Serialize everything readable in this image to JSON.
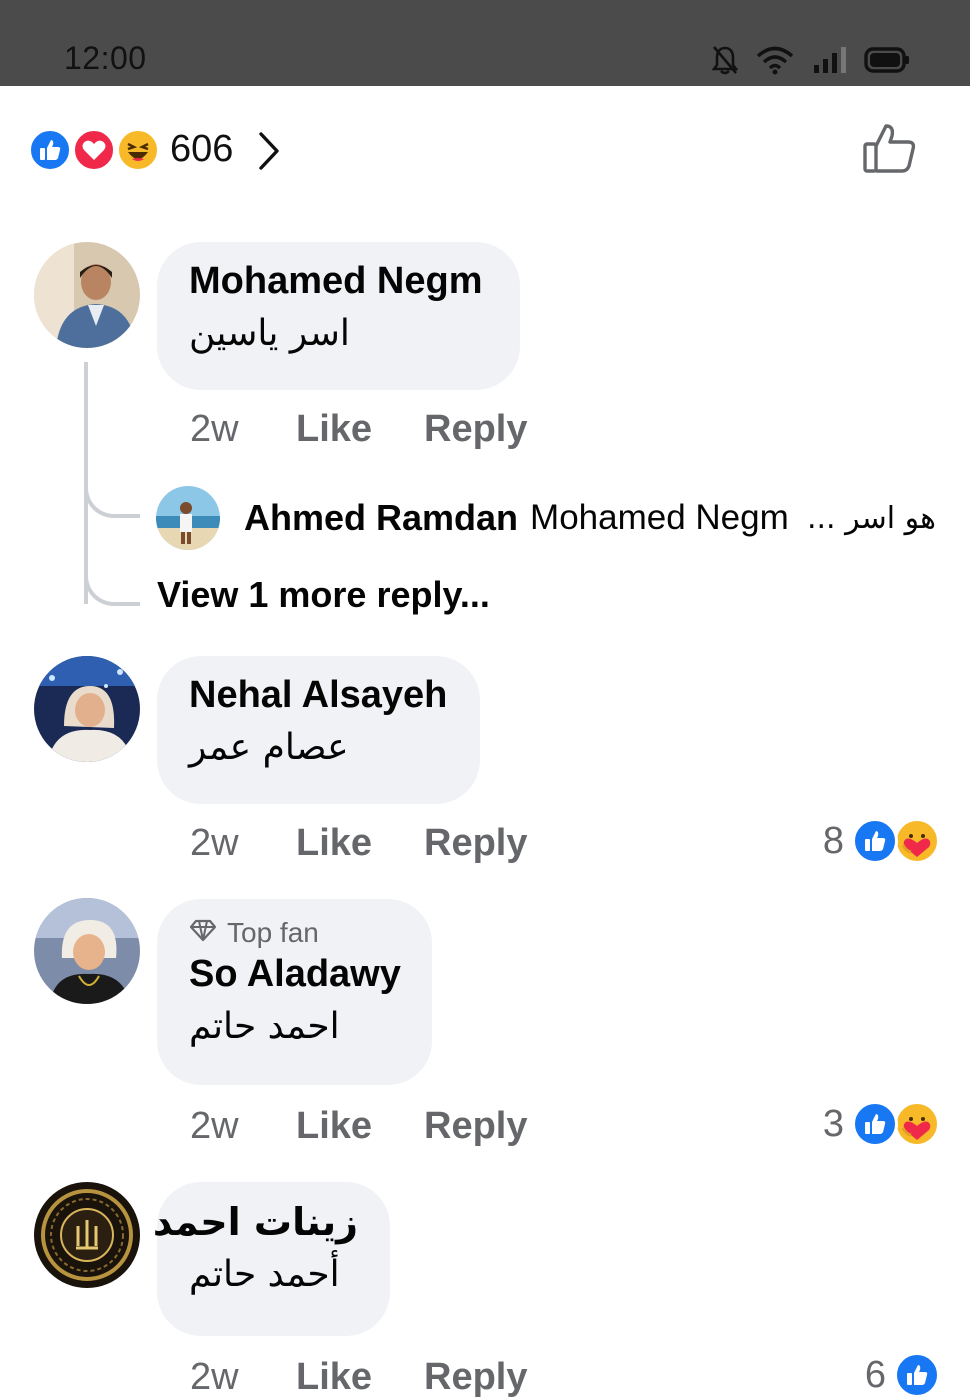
{
  "status_bar": {
    "time": "12:00",
    "icons": [
      "bell-off-icon",
      "wifi-icon",
      "signal-icon",
      "battery-icon"
    ]
  },
  "post_reactions": {
    "icons": [
      "like-reaction-icon",
      "love-reaction-icon",
      "haha-reaction-icon"
    ],
    "count": "606"
  },
  "comments": [
    {
      "author": "Mohamed Negm",
      "text": "اسر ياسين",
      "time": "2w",
      "like_label": "Like",
      "reply_label": "Reply",
      "reply_preview": {
        "author": "Ahmed Ramdan",
        "mention": "Mohamed Negm",
        "snippet": "هو اسر ..."
      },
      "view_more": "View 1 more reply..."
    },
    {
      "author": "Nehal Alsayeh",
      "text": "عصام عمر",
      "time": "2w",
      "like_label": "Like",
      "reply_label": "Reply",
      "reaction_count": "8",
      "reaction_icons": [
        "like-reaction-icon",
        "care-reaction-icon"
      ]
    },
    {
      "badge": "Top fan",
      "author": "So Aladawy",
      "text": "احمد حاتم",
      "time": "2w",
      "like_label": "Like",
      "reply_label": "Reply",
      "reaction_count": "3",
      "reaction_icons": [
        "like-reaction-icon",
        "care-reaction-icon"
      ]
    },
    {
      "author": "زينات احمد",
      "text": "أحمد حاتم",
      "time": "2w",
      "like_label": "Like",
      "reply_label": "Reply",
      "reaction_count": "6",
      "reaction_icons": [
        "like-reaction-icon"
      ]
    }
  ],
  "colors": {
    "facebook_blue": "#1877f2",
    "bubble_gray": "#f0f2f5",
    "secondary_text": "#65676b",
    "love_red": "#f02849",
    "haha_yellow": "#f7b928"
  }
}
